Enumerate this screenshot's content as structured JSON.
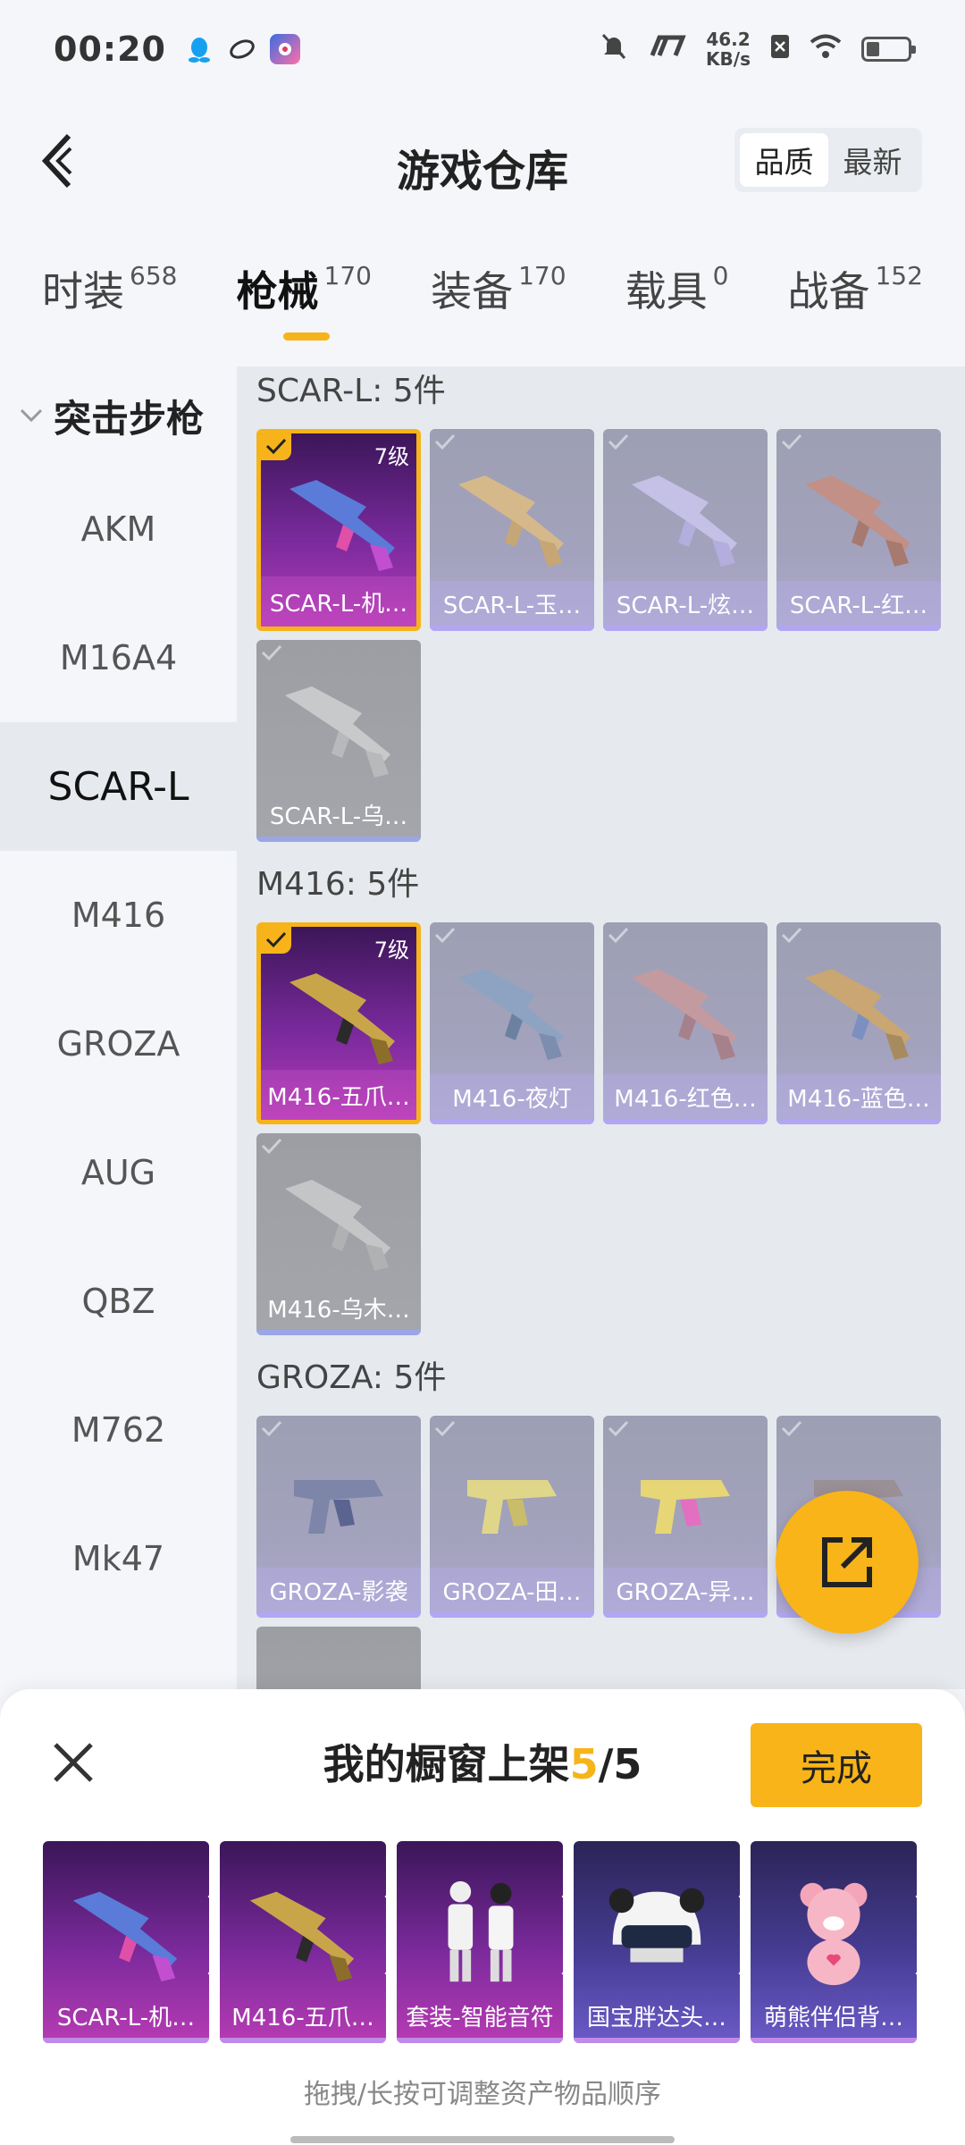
{
  "status": {
    "time": "00:20",
    "net_speed_value": "46.2",
    "net_speed_unit": "KB/s"
  },
  "header": {
    "title": "游戏仓库",
    "sort": {
      "options": [
        "品质",
        "最新"
      ],
      "active_index": 0
    }
  },
  "tabs": [
    {
      "label": "时装",
      "count": "658"
    },
    {
      "label": "枪械",
      "count": "170"
    },
    {
      "label": "装备",
      "count": "170"
    },
    {
      "label": "载具",
      "count": "0"
    },
    {
      "label": "战备",
      "count": "152"
    }
  ],
  "sidebar": {
    "category": "突击步枪",
    "items": [
      "AKM",
      "M16A4",
      "SCAR-L",
      "M416",
      "GROZA",
      "AUG",
      "QBZ",
      "M762",
      "Mk47"
    ],
    "active_index": 2
  },
  "groups": [
    {
      "title": "SCAR-L: 5件",
      "items": [
        {
          "name": "SCAR-L-机…",
          "level": "7级",
          "selected": true
        },
        {
          "name": "SCAR-L-玉…",
          "selected": false
        },
        {
          "name": "SCAR-L-炫…",
          "selected": false
        },
        {
          "name": "SCAR-L-红…",
          "selected": false
        },
        {
          "name": "SCAR-L-乌…",
          "selected": false
        }
      ]
    },
    {
      "title": "M416: 5件",
      "items": [
        {
          "name": "M416-五爪…",
          "level": "7级",
          "selected": true
        },
        {
          "name": "M416-夜灯",
          "selected": false
        },
        {
          "name": "M416-红色…",
          "selected": false
        },
        {
          "name": "M416-蓝色…",
          "selected": false
        },
        {
          "name": "M416-乌木…",
          "selected": false
        }
      ]
    },
    {
      "title": "GROZA: 5件",
      "items": [
        {
          "name": "GROZA-影袭",
          "selected": false
        },
        {
          "name": "GROZA-田…",
          "selected": false
        },
        {
          "name": "GROZA-异…",
          "selected": false
        },
        {
          "name": "",
          "selected": false
        }
      ]
    }
  ],
  "sheet": {
    "title_prefix": "我的橱窗上架",
    "current": "5",
    "separator": "/",
    "total": "5",
    "done_label": "完成",
    "items": [
      {
        "name": "SCAR-L-机…"
      },
      {
        "name": "M416-五爪…"
      },
      {
        "name": "套装-智能音符"
      },
      {
        "name": "国宝胖达头…"
      },
      {
        "name": "萌熊伴侣背…"
      }
    ],
    "hint": "拖拽/长按可调整资产物品顺序"
  },
  "colors": {
    "accent": "#f6b41a",
    "panel": "#e6e9ee"
  }
}
